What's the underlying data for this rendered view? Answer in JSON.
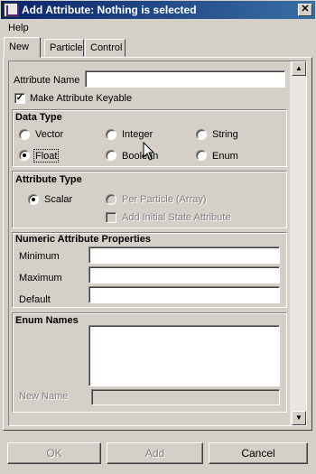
{
  "window": {
    "title": "Add Attribute: Nothing is selected",
    "close_glyph": "✕"
  },
  "menu": {
    "help": "Help"
  },
  "tabs": [
    {
      "label": "New",
      "active": true
    },
    {
      "label": "Particle",
      "active": false
    },
    {
      "label": "Control",
      "active": false
    }
  ],
  "attribute_name": {
    "label": "Attribute Name",
    "value": ""
  },
  "make_keyable": {
    "label": "Make Attribute Keyable",
    "checked": true
  },
  "data_type": {
    "title": "Data Type",
    "options": [
      {
        "label": "Vector",
        "selected": false
      },
      {
        "label": "Integer",
        "selected": false
      },
      {
        "label": "String",
        "selected": false
      },
      {
        "label": "Float",
        "selected": true
      },
      {
        "label": "Boolean",
        "selected": false
      },
      {
        "label": "Enum",
        "selected": false
      }
    ]
  },
  "attribute_type": {
    "title": "Attribute Type",
    "scalar": {
      "label": "Scalar",
      "selected": true
    },
    "per_particle": {
      "label": "Per Particle (Array)",
      "selected": false,
      "enabled": false
    },
    "initial_state": {
      "label": "Add Initial State Attribute",
      "checked": false,
      "enabled": false
    }
  },
  "numeric": {
    "title": "Numeric Attribute Properties",
    "minimum": {
      "label": "Minimum",
      "value": ""
    },
    "maximum": {
      "label": "Maximum",
      "value": ""
    },
    "default": {
      "label": "Default",
      "value": ""
    }
  },
  "enum_names": {
    "title": "Enum Names",
    "list_value": "",
    "new_name_label": "New Name",
    "new_name_value": ""
  },
  "buttons": {
    "ok": "OK",
    "add": "Add",
    "cancel": "Cancel"
  },
  "scrollbar": {
    "up_glyph": "▲",
    "down_glyph": "▼"
  }
}
